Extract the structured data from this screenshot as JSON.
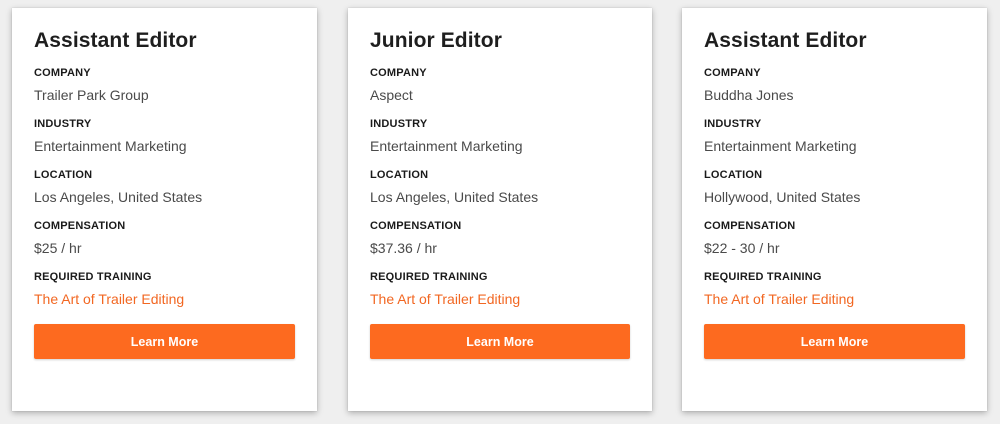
{
  "colors": {
    "accent": "#fd6a1f",
    "link": "#f26722",
    "background": "#efefef",
    "card": "#ffffff"
  },
  "labels": {
    "company": "COMPANY",
    "industry": "INDUSTRY",
    "location": "LOCATION",
    "compensation": "COMPENSATION",
    "required_training": "REQUIRED TRAINING"
  },
  "jobs": [
    {
      "title": "Assistant Editor",
      "company": "Trailer Park Group",
      "industry": "Entertainment Marketing",
      "location": "Los Angeles, United States",
      "compensation": "$25 / hr",
      "required_training": "The Art of Trailer Editing",
      "button_label": "Learn More"
    },
    {
      "title": "Junior Editor",
      "company": "Aspect",
      "industry": "Entertainment Marketing",
      "location": "Los Angeles, United States",
      "compensation": "$37.36 / hr",
      "required_training": "The Art of Trailer Editing",
      "button_label": "Learn More"
    },
    {
      "title": "Assistant Editor",
      "company": "Buddha Jones",
      "industry": "Entertainment Marketing",
      "location": "Hollywood, United States",
      "compensation": "$22 - 30 / hr",
      "required_training": "The Art of Trailer Editing",
      "button_label": "Learn More"
    }
  ]
}
